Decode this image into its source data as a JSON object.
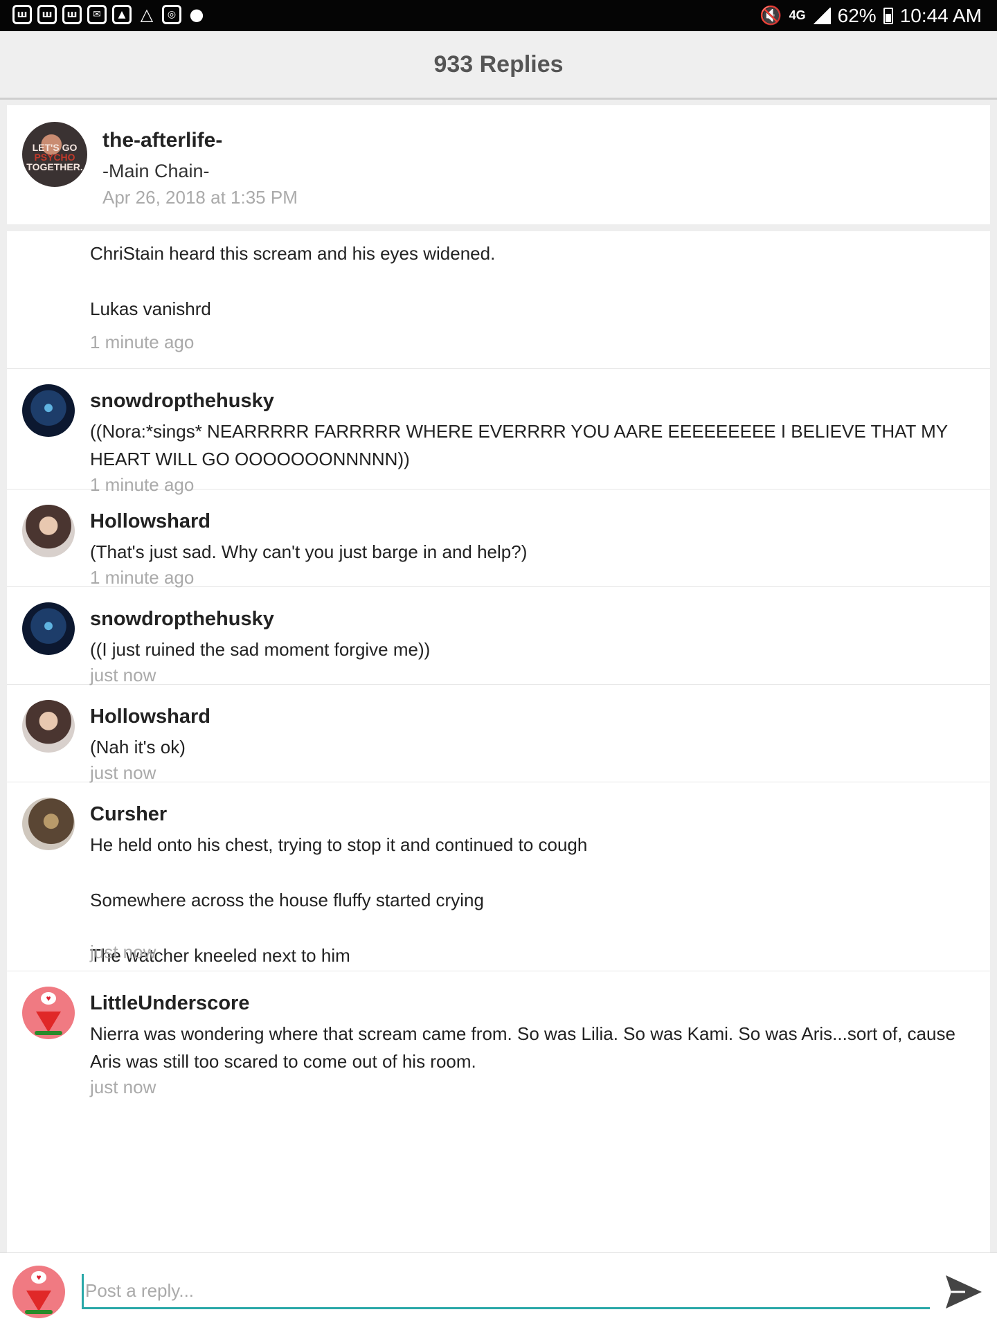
{
  "status_bar": {
    "icons": [
      "w-icon",
      "w-icon",
      "w-icon",
      "mail-icon",
      "gallery-icon",
      "drive-icon",
      "instagram-icon",
      "bubble-icon"
    ],
    "network": "4G",
    "battery": "62%",
    "time": "10:44 AM"
  },
  "header": {
    "title": "933 Replies"
  },
  "original_post": {
    "username": "the-afterlife-",
    "subtitle": "-Main Chain-",
    "timestamp": "Apr 26, 2018 at 1:35 PM",
    "avatar_text": [
      "LET'S GO",
      "PSYCHO",
      "TOGETHER."
    ]
  },
  "posts": [
    {
      "username": "",
      "body": "ChriStain heard this scream and his eyes widened.\n\nLukas vanishrd",
      "time": "1 minute ago"
    },
    {
      "username": "snowdropthehusky",
      "body": "((Nora:*sings* NEARRRRR FARRRRR WHERE EVERRRR YOU AARE EEEEEEEEE I BELIEVE THAT MY HEART WILL GO OOOOOOONNNNN))",
      "time": "1 minute ago"
    },
    {
      "username": "Hollowshard",
      "body": "(That's just sad. Why can't you just barge in and help?)",
      "time": "1 minute ago"
    },
    {
      "username": "snowdropthehusky",
      "body": "((I just ruined the sad moment forgive me))",
      "time": "just now"
    },
    {
      "username": "Hollowshard",
      "body": "(Nah it's ok)",
      "time": "just now"
    },
    {
      "username": "Cursher",
      "body": "He held onto his chest, trying to stop it and continued to cough\n\nSomewhere across the house fluffy started crying\n\nThe watcher kneeled next to him",
      "time": "just now"
    },
    {
      "username": "LittleUnderscore",
      "body": "Nierra was wondering where that scream came from. So was Lilia. So was Kami. So was Aris...sort of, cause Aris was still too scared to come out of his room.",
      "time": "just now"
    }
  ],
  "reply": {
    "placeholder": "Post a reply..."
  },
  "colors": {
    "accent": "#29a8a8",
    "muted": "#aaaaaa"
  }
}
